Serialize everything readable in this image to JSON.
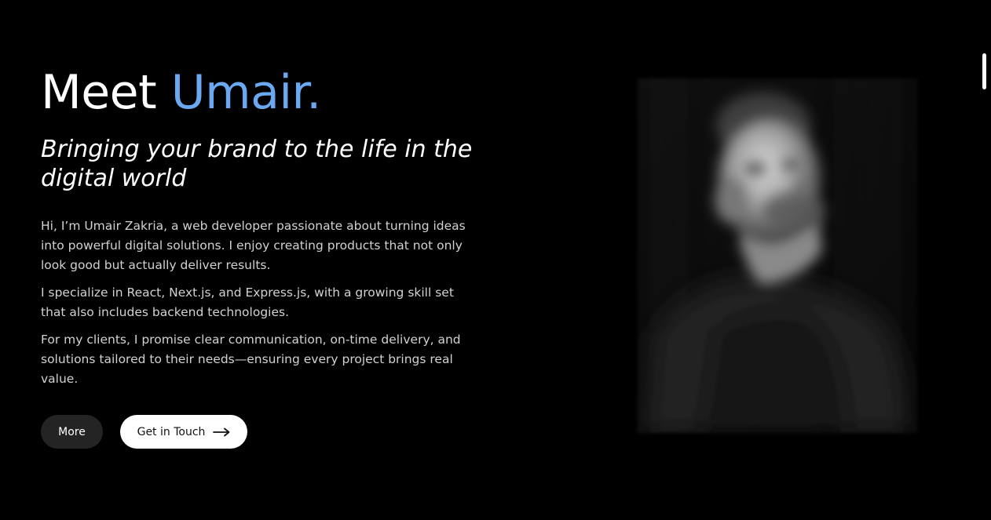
{
  "hero": {
    "title_prefix": "Meet ",
    "title_name": "Umair.",
    "tagline": "Bringing your brand to the life in the digital world",
    "bio": [
      "Hi, I’m Umair Zakria, a web developer passionate about turning ideas into powerful digital solutions. I enjoy creating products that not only look good but actually deliver results.",
      "I specialize in React, Next.js, and Express.js, with a growing skill set that also includes backend technologies.",
      "For my clients, I promise clear communication, on-time delivery, and solutions tailored to their needs—ensuring every project brings real value."
    ]
  },
  "buttons": {
    "more_label": "More",
    "touch_label": "Get in Touch",
    "touch_icon": "arrow-right-icon"
  },
  "portrait": {
    "alt": "Portrait of Umair Zakria (blurred, black and white)"
  },
  "colors": {
    "background": "#000000",
    "accent": "#6aa9f2",
    "text": "#ffffff",
    "body_text": "#d2d2d2",
    "secondary_button": "#242424"
  }
}
